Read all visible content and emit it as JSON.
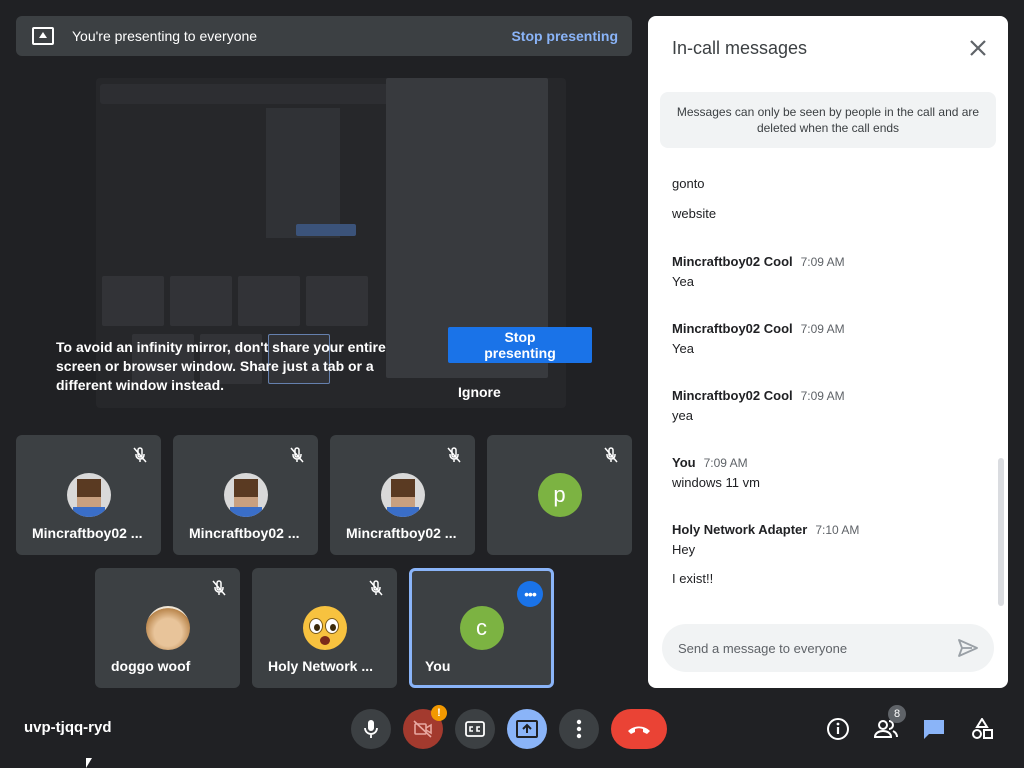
{
  "banner": {
    "text": "You're presenting to everyone",
    "stop_label": "Stop presenting"
  },
  "preview": {
    "advice": "To avoid an infinity mirror, don't share your entire screen or browser window. Share just a tab or a different window instead.",
    "stop_label": "Stop presenting",
    "ignore_label": "Ignore"
  },
  "participants": [
    {
      "name": "Mincraftboy02 ...",
      "avatar": "minecraft-avatar",
      "muted": true
    },
    {
      "name": "Mincraftboy02 ...",
      "avatar": "minecraft-avatar",
      "muted": true
    },
    {
      "name": "Mincraftboy02 ...",
      "avatar": "minecraft-avatar",
      "muted": true
    },
    {
      "name": "",
      "avatar_letter": "p",
      "avatar_color": "#7cb342",
      "muted": true
    },
    {
      "name": "doggo woof",
      "avatar": "dog-photo",
      "muted": true
    },
    {
      "name": "Holy Network ...",
      "avatar": "emoji-face",
      "muted": true
    },
    {
      "name": "You",
      "avatar_letter": "c",
      "avatar_color": "#7cb342",
      "muted": false
    }
  ],
  "bottom": {
    "meeting_code": "uvp-tjqq-ryd",
    "camera_warning": "!",
    "people_count": "8"
  },
  "chat": {
    "title": "In-call messages",
    "note": "Messages can only be seen by people in the call and are deleted when the call ends",
    "messages": [
      {
        "sender": "",
        "time": "",
        "text": "gonto"
      },
      {
        "sender": "",
        "time": "",
        "text": "website"
      },
      {
        "sender": "Mincraftboy02 Cool",
        "time": "7:09 AM",
        "text": "Yea"
      },
      {
        "sender": "Mincraftboy02 Cool",
        "time": "7:09 AM",
        "text": "Yea"
      },
      {
        "sender": "Mincraftboy02 Cool",
        "time": "7:09 AM",
        "text": "yea"
      },
      {
        "sender": "You",
        "time": "7:09 AM",
        "text": "windows 11 vm"
      },
      {
        "sender": "Holy Network Adapter",
        "time": "7:10 AM",
        "text": "Hey"
      },
      {
        "sender": "",
        "time": "",
        "text": "I exist!!"
      }
    ],
    "input_placeholder": "Send a message to everyone"
  },
  "colors": {
    "accent_blue": "#8ab4f8",
    "button_blue": "#1a73e8",
    "end_call_red": "#ea4335",
    "warning_orange": "#f29900"
  }
}
